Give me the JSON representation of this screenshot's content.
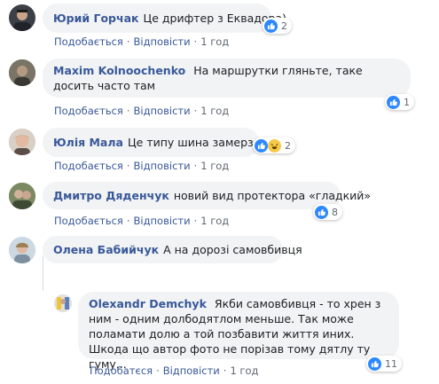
{
  "actions": {
    "like": "Подобається",
    "reply": "Відповісти",
    "like_alt": "Подобатєся"
  },
  "comments": [
    {
      "author": "Юрий Горчак",
      "text": "Це дрифтер з Еквадора)",
      "time": "1 год",
      "reactions": "2",
      "reaction_icons": [
        "like-icon"
      ]
    },
    {
      "author": "Maxim Kolnoochenko",
      "text": "На маршрутки гляньте, таке досить часто там",
      "time": "1 год",
      "reactions": "1",
      "reaction_icons": [
        "like-icon"
      ]
    },
    {
      "author": "Юлія Мала",
      "text": "Це типу шина замерзла?)",
      "time": "1 год",
      "reactions": "2",
      "reaction_icons": [
        "like-icon",
        "haha-icon"
      ]
    },
    {
      "author": "Дмитро Дяденчук",
      "text": "новий вид протектора «гладкий»",
      "time": "1 год",
      "reactions": "8",
      "reaction_icons": [
        "like-icon"
      ]
    },
    {
      "author": "Олена Бабийчук",
      "text": "А на дорозі самовбивця",
      "time": "",
      "reactions": "",
      "reaction_icons": []
    },
    {
      "author": "Olexandr Demchyk",
      "text": "Якби самовбивця - то хрен з ним - одним долбодятлом меньше. Так може поламати долю а той позбавити життя иних. Шкода що автор фото не порізав тому дятлу ту гуму...",
      "time": "1 год",
      "reactions": "11",
      "reaction_icons": [
        "like-icon"
      ]
    }
  ],
  "colors": {
    "link": "#385898",
    "bubble": "#f2f3f5",
    "like": "#2d88ff",
    "meta": "#606770"
  }
}
